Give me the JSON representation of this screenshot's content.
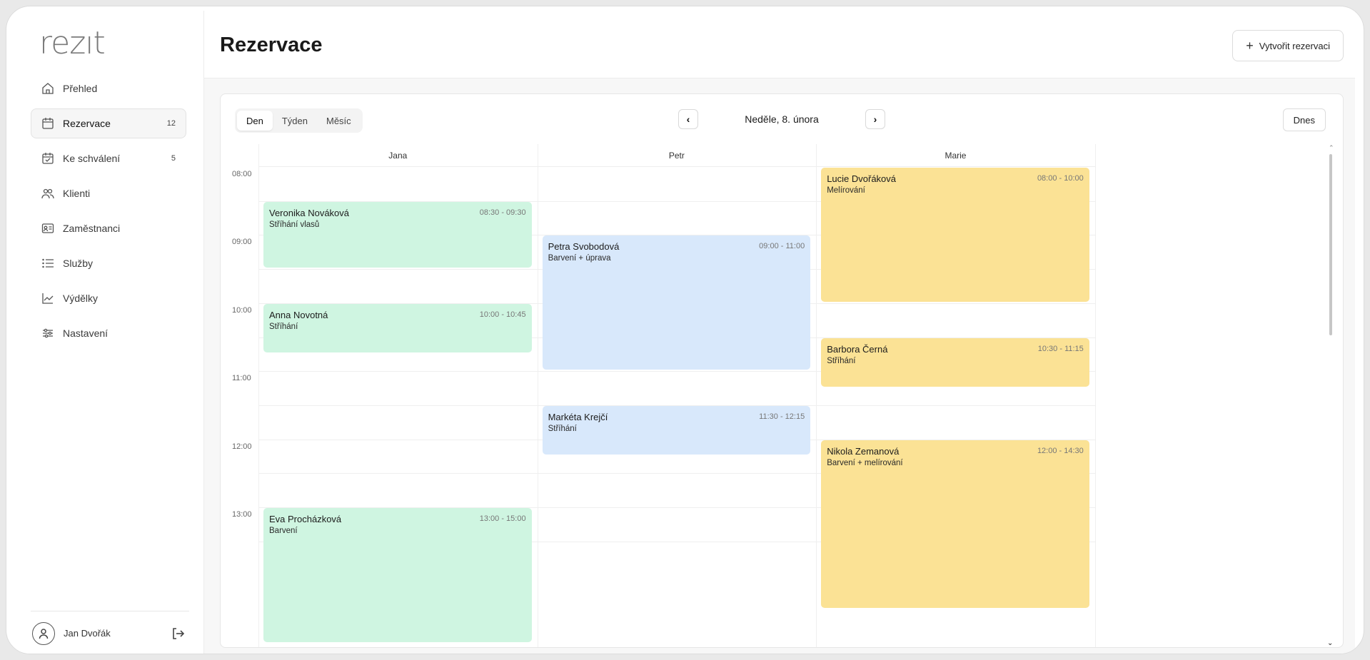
{
  "brand": {
    "logo": "rezıt"
  },
  "sidebar": {
    "items": [
      {
        "label": "Přehled",
        "icon": "home-icon",
        "badge": ""
      },
      {
        "label": "Rezervace",
        "icon": "calendar-icon",
        "badge": "12"
      },
      {
        "label": "Ke schválení",
        "icon": "calendar-check-icon",
        "badge": "5"
      },
      {
        "label": "Klienti",
        "icon": "users-icon",
        "badge": ""
      },
      {
        "label": "Zaměstnanci",
        "icon": "id-card-icon",
        "badge": ""
      },
      {
        "label": "Služby",
        "icon": "list-icon",
        "badge": ""
      },
      {
        "label": "Výdělky",
        "icon": "chart-line-icon",
        "badge": ""
      },
      {
        "label": "Nastavení",
        "icon": "sliders-icon",
        "badge": ""
      }
    ],
    "active_index": 1,
    "user": {
      "name": "Jan Dvořák"
    }
  },
  "header": {
    "title": "Rezervace",
    "create_button": "Vytvořit rezervaci"
  },
  "calendar": {
    "views": [
      "Den",
      "Týden",
      "Měsíc"
    ],
    "active_view": "Den",
    "date_label": "Neděle, 8. února",
    "today_button": "Dnes",
    "hours": [
      "08:00",
      "09:00",
      "10:00",
      "11:00",
      "12:00",
      "13:00"
    ],
    "staff": [
      "Jana",
      "Petr",
      "Marie"
    ],
    "events": [
      {
        "staff": 0,
        "name": "Veronika Nováková",
        "service": "Stříhání vlasů",
        "time": "08:30 - 09:30",
        "color": "#cff5e1"
      },
      {
        "staff": 0,
        "name": "Anna Novotná",
        "service": "Stříhání",
        "time": "10:00 - 10:45",
        "color": "#cff5e1"
      },
      {
        "staff": 0,
        "name": "Eva Procházková",
        "service": "Barvení",
        "time": "13:00 - 15:00",
        "color": "#cff5e1"
      },
      {
        "staff": 1,
        "name": "Petra Svobodová",
        "service": "Barvení + úprava",
        "time": "09:00 - 11:00",
        "color": "#d8e8fb"
      },
      {
        "staff": 1,
        "name": "Markéta Krejčí",
        "service": "Stříhání",
        "time": "11:30 - 12:15",
        "color": "#d8e8fb"
      },
      {
        "staff": 2,
        "name": "Lucie Dvořáková",
        "service": "Melírování",
        "time": "08:00 - 10:00",
        "color": "#fbe295"
      },
      {
        "staff": 2,
        "name": "Barbora Černá",
        "service": "Stříhání",
        "time": "10:30 - 11:15",
        "color": "#fbe295"
      },
      {
        "staff": 2,
        "name": "Nikola Zemanová",
        "service": "Barvení + melírování",
        "time": "12:00 - 14:30",
        "color": "#fbe295"
      }
    ]
  }
}
